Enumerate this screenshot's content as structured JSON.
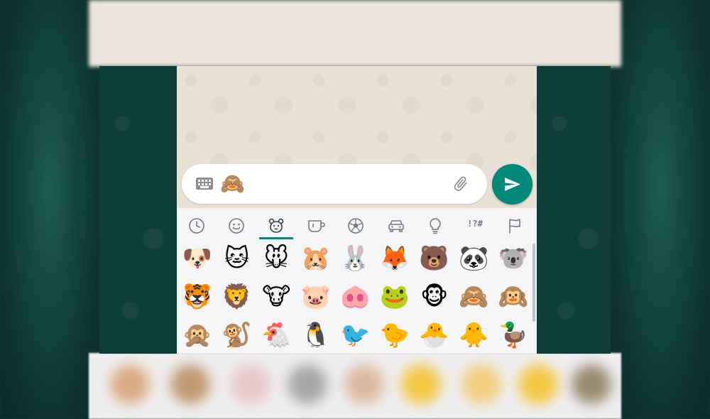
{
  "message_input": {
    "typed_text": "🙈",
    "keyboard_icon": "keyboard-icon",
    "attach_icon": "paperclip-icon"
  },
  "send_button": {
    "icon": "send-icon",
    "color": "#00897b"
  },
  "emoji_categories": [
    {
      "id": "recent",
      "icon": "clock-icon"
    },
    {
      "id": "smileys",
      "icon": "smiley-icon"
    },
    {
      "id": "animals",
      "icon": "bear-icon",
      "active": true
    },
    {
      "id": "food",
      "icon": "cup-icon"
    },
    {
      "id": "activity",
      "icon": "soccer-ball-icon"
    },
    {
      "id": "travel",
      "icon": "car-icon"
    },
    {
      "id": "objects",
      "icon": "lightbulb-icon"
    },
    {
      "id": "symbols",
      "icon": "symbols-icon",
      "text": "!?#"
    },
    {
      "id": "flags",
      "icon": "flag-icon"
    }
  ],
  "emoji_grid": [
    [
      "🐶",
      "🐱",
      "🐭",
      "🐹",
      "🐰",
      "🦊",
      "🐻",
      "🐼",
      "🐨"
    ],
    [
      "🐯",
      "🦁",
      "🐮",
      "🐷",
      "🐽",
      "🐸",
      "🐵",
      "🙈",
      "🙉"
    ],
    [
      "🙊",
      "🐒",
      "🐔",
      "🐧",
      "🐦",
      "🐤",
      "🐣",
      "🐥",
      "🦆"
    ]
  ],
  "colors": {
    "accent": "#00897b",
    "icon_gray": "#767a7e",
    "panel_bg": "#f4f5f7",
    "chat_bg": "#e8e1d6",
    "side_bg": "#103e39"
  }
}
